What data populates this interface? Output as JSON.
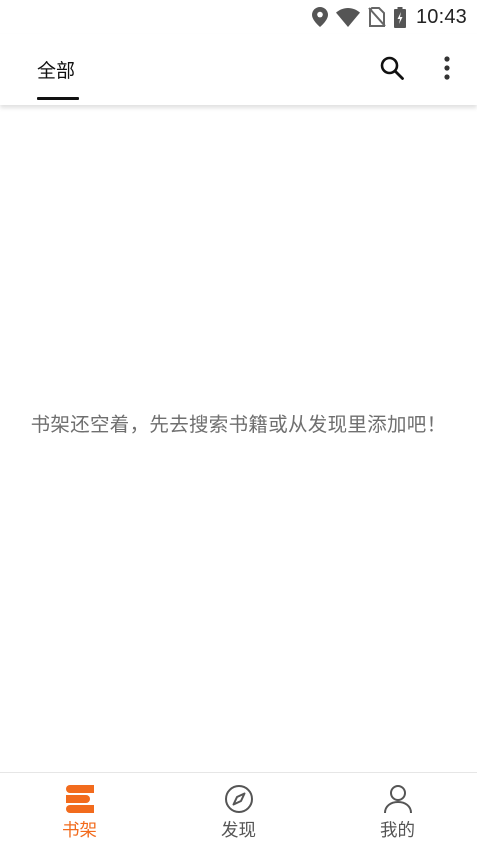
{
  "status_bar": {
    "time": "10:43",
    "icons": [
      "location-icon",
      "wifi-icon",
      "no-sim-icon",
      "battery-charging-icon"
    ]
  },
  "app_bar": {
    "tabs": [
      {
        "label": "全部",
        "selected": true
      }
    ],
    "actions": [
      "search-icon",
      "more-vert-icon"
    ]
  },
  "empty_state": {
    "message": "书架还空着，先去搜索书籍或从发现里添加吧！"
  },
  "bottom_nav": {
    "items": [
      {
        "label": "书架",
        "icon": "bookshelf-icon",
        "active": true
      },
      {
        "label": "发现",
        "icon": "compass-icon",
        "active": false
      },
      {
        "label": "我的",
        "icon": "person-icon",
        "active": false
      }
    ]
  },
  "colors": {
    "accent": "#f26b1d",
    "text_primary": "#111111",
    "text_secondary": "#6f6f6f",
    "nav_inactive": "#555555"
  }
}
